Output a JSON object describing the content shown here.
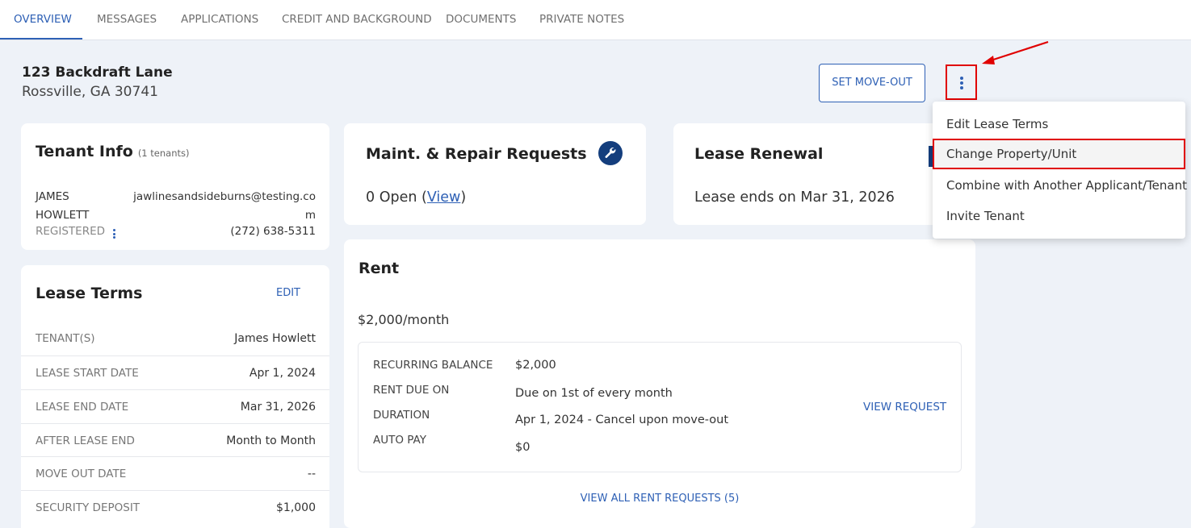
{
  "tabs": [
    {
      "label": "OVERVIEW",
      "active": true
    },
    {
      "label": "MESSAGES"
    },
    {
      "label": "APPLICATIONS"
    },
    {
      "label": "CREDIT AND BACKGROUND"
    },
    {
      "label": "DOCUMENTS"
    },
    {
      "label": "PRIVATE NOTES"
    }
  ],
  "address": {
    "line1": "123 Backdraft Lane",
    "line2": "Rossville, GA 30741"
  },
  "actions": {
    "set_move_out": "SET MOVE-OUT"
  },
  "tenant_info": {
    "title": "Tenant Info",
    "count": "(1 tenants)",
    "first_name": "JAMES",
    "last_name": "HOWLETT",
    "status": "REGISTERED",
    "email": "jawlinesandsideburns@testing.com",
    "phone": "(272) 638-5311"
  },
  "lease_terms": {
    "title": "Lease Terms",
    "edit": "EDIT",
    "rows": [
      {
        "label": "TENANT(S)",
        "value": "James Howlett"
      },
      {
        "label": "LEASE START DATE",
        "value": "Apr 1, 2024"
      },
      {
        "label": "LEASE END DATE",
        "value": "Mar 31, 2026"
      },
      {
        "label": "AFTER LEASE END",
        "value": "Month to Month"
      },
      {
        "label": "MOVE OUT DATE",
        "value": "--"
      },
      {
        "label": "SECURITY DEPOSIT",
        "value": "$1,000"
      }
    ]
  },
  "maintenance": {
    "title": "Maint. & Repair Requests",
    "open_prefix": "0 Open (",
    "view_link": "View",
    "open_suffix": ")"
  },
  "lease_renewal": {
    "title": "Lease Renewal",
    "text": "Lease ends on Mar 31, 2026"
  },
  "rent": {
    "title": "Rent",
    "amount": "$2,000/month",
    "details": [
      {
        "label": "RECURRING BALANCE",
        "value": "$2,000"
      },
      {
        "label": "RENT DUE ON",
        "value": "Due on 1st of every month"
      },
      {
        "label": "DURATION",
        "value": "Apr 1, 2024 - Cancel upon move-out"
      },
      {
        "label": "AUTO PAY",
        "value": "$0"
      }
    ],
    "view_request": "VIEW REQUEST",
    "view_all": "VIEW ALL RENT REQUESTS (5)"
  },
  "menu": {
    "items": [
      {
        "label": "Edit Lease Terms"
      },
      {
        "label": "Change Property/Unit",
        "highlighted": true
      },
      {
        "label": "Combine with Another Applicant/Tenant"
      },
      {
        "label": "Invite Tenant"
      }
    ]
  },
  "colors": {
    "accent": "#2e60b5",
    "highlight_border": "#e00000",
    "icon_dark": "#143e7d"
  }
}
